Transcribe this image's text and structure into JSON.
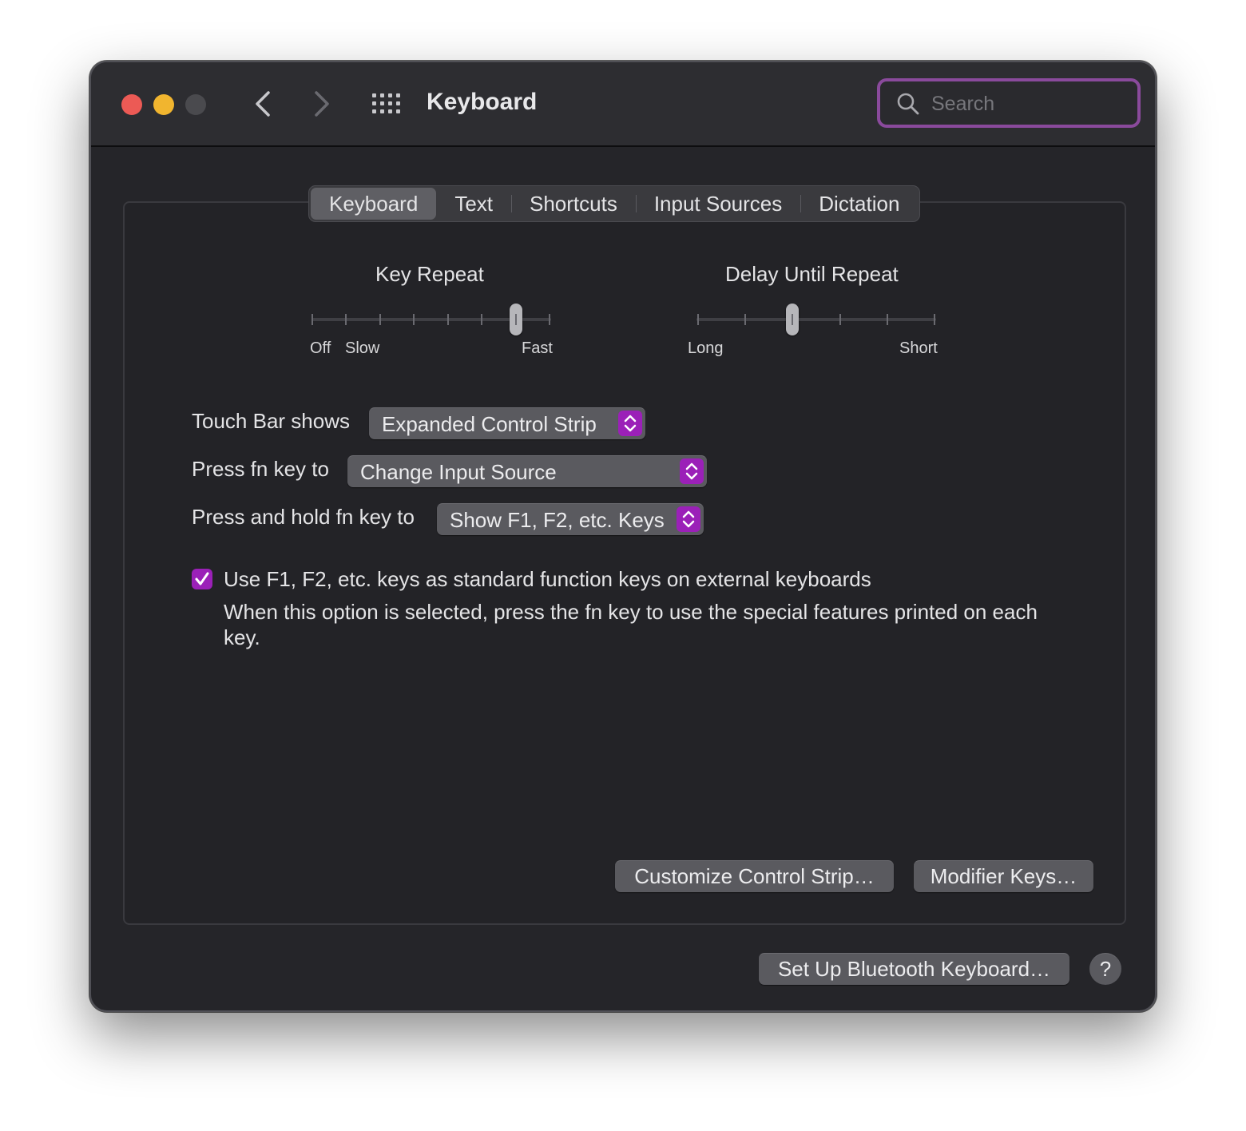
{
  "window": {
    "title": "Keyboard",
    "search_placeholder": "Search"
  },
  "tabs": [
    {
      "label": "Keyboard",
      "active": true
    },
    {
      "label": "Text",
      "active": false
    },
    {
      "label": "Shortcuts",
      "active": false
    },
    {
      "label": "Input Sources",
      "active": false
    },
    {
      "label": "Dictation",
      "active": false
    }
  ],
  "key_repeat": {
    "title": "Key Repeat",
    "labels": {
      "off": "Off",
      "slow": "Slow",
      "fast": "Fast"
    },
    "tick_count": 8,
    "selected_tick": 7
  },
  "delay_until_repeat": {
    "title": "Delay Until Repeat",
    "labels": {
      "long": "Long",
      "short": "Short"
    },
    "tick_count": 6,
    "selected_tick": 3
  },
  "settings": {
    "touch_bar": {
      "label": "Touch Bar shows",
      "value": "Expanded Control Strip"
    },
    "fn_key": {
      "label": "Press fn key to",
      "value": "Change Input Source"
    },
    "hold_fn_key": {
      "label": "Press and hold fn key to",
      "value": "Show F1, F2, etc. Keys"
    }
  },
  "function_keys_option": {
    "checked": true,
    "label": "Use F1, F2, etc. keys as standard function keys on external keyboards",
    "description": "When this option is selected, press the fn key to use the special features printed on each key."
  },
  "buttons": {
    "customize": "Customize Control Strip…",
    "modifier": "Modifier Keys…",
    "bluetooth": "Set Up Bluetooth Keyboard…",
    "help": "?"
  },
  "colors": {
    "accent": "#9b20b8",
    "focus_ring": "#8a4a9c",
    "close": "#ec5a55",
    "minimize": "#f1b52f",
    "zoom_disabled": "#4a4a4e"
  }
}
